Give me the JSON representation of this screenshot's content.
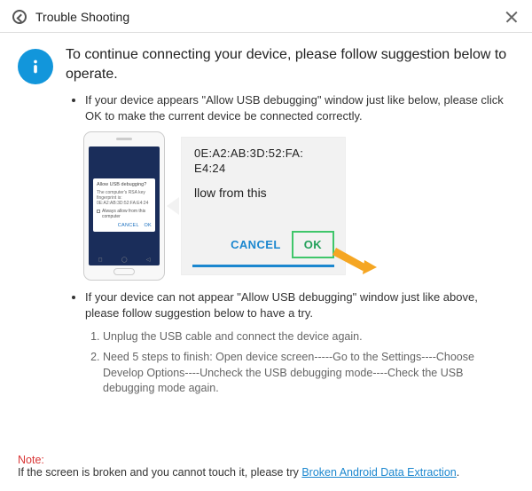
{
  "title": "Trouble Shooting",
  "headline": "To continue connecting your device, please follow suggestion below to operate.",
  "bullet1": "If your device appears \"Allow USB debugging\" window just like below, please click OK to make the current device  be connected correctly.",
  "bullet2": "If your device can not appear \"Allow USB debugging\" window just like above, please follow suggestion below to have a try.",
  "phone_dialog": {
    "title": "Allow USB debugging?",
    "body": "The computer's RSA key fingerprint is:\n0E:A2:AB:3D:52:FA:E4:24",
    "checkbox": "Always allow from this computer",
    "cancel": "CANCEL",
    "ok": "OK"
  },
  "zoom": {
    "mac_line1": "0E:A2:AB:3D:52:FA:",
    "mac_line2": "E4:24",
    "prompt": "llow from this",
    "cancel": "CANCEL",
    "ok": "OK"
  },
  "steps": [
    "Unplug the USB cable and connect the device again.",
    "Need 5 steps to finish: Open device screen-----Go to the Settings----Choose Develop Options----Uncheck the USB debugging mode----Check the USB debugging mode again."
  ],
  "note_label": "Note:",
  "note_text": "If the screen is broken and you cannot touch it, please try ",
  "note_link": "Broken Android Data Extraction",
  "note_suffix": "."
}
